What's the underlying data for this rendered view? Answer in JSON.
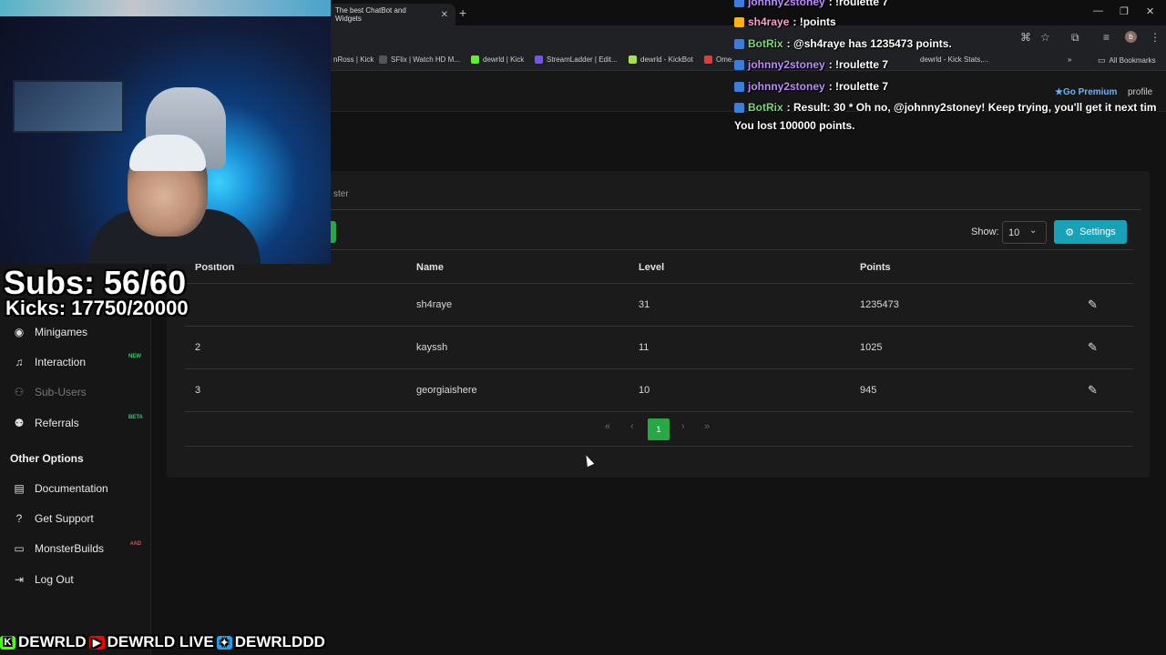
{
  "browser": {
    "tab_title": "The best ChatBot and Widgets",
    "bookmarks": [
      "nRoss | Kick",
      "SFlix | Watch HD M...",
      "dewrld | Kick",
      "StreamLadder | Edit...",
      "dewrld - KickBot",
      "Ome.."
    ],
    "bookmarks_right": [
      "dewrld - Kick Stats,...",
      "All Bookmarks"
    ]
  },
  "header": {
    "premium_label": "Go Premium",
    "profile_label": "profile"
  },
  "sidebar": {
    "items": [
      {
        "label": "Minigames",
        "icon": "gamepad-icon",
        "badge": ""
      },
      {
        "label": "Interaction",
        "icon": "music-icon",
        "badge": "NEW"
      },
      {
        "label": "Sub-Users",
        "icon": "users-icon",
        "badge": ""
      },
      {
        "label": "Referrals",
        "icon": "referral-icon",
        "badge": "BETA"
      }
    ],
    "section_heading": "Other Options",
    "options": [
      {
        "label": "Documentation",
        "icon": "book-icon",
        "badge": ""
      },
      {
        "label": "Get Support",
        "icon": "question-icon",
        "badge": ""
      },
      {
        "label": "MonsterBuilds",
        "icon": "laptop-icon",
        "badge": "#AD"
      },
      {
        "label": "Log Out",
        "icon": "logout-icon",
        "badge": ""
      }
    ]
  },
  "main": {
    "tab_label": "ster",
    "show_label": "Show:",
    "show_value": "10",
    "settings_label": "Settings",
    "columns": [
      "Position",
      "Name",
      "Level",
      "Points"
    ],
    "rows": [
      {
        "position": "",
        "name": "sh4raye",
        "level": "31",
        "points": "1235473"
      },
      {
        "position": "2",
        "name": "kayssh",
        "level": "11",
        "points": "1025"
      },
      {
        "position": "3",
        "name": "georgiaishere",
        "level": "10",
        "points": "945"
      }
    ],
    "pagination": {
      "first": "«",
      "prev": "‹",
      "current": "1",
      "next": "›",
      "last": "»"
    }
  },
  "overlay": {
    "subs": "Subs: 56/60",
    "kicks": "Kicks: 17750/20000",
    "socials": [
      {
        "icon": "kick-icon",
        "label": "DEWRLD",
        "color": "#53fc18"
      },
      {
        "icon": "youtube-icon",
        "label": "DEWRLD LIVE",
        "color": "#ff0000"
      },
      {
        "icon": "twitter-icon",
        "label": "DEWRLDDD",
        "color": "#1da1f2"
      }
    ]
  },
  "chat": [
    {
      "user": "johnny2stoney",
      "message": ": !roulette 7",
      "class": "user-j"
    },
    {
      "user": "sh4raye",
      "message": ": !points",
      "class": "user-s"
    },
    {
      "user": "BotRix",
      "message": ": @sh4raye has 1235473 points.",
      "class": "user-b"
    },
    {
      "user": "johnny2stoney",
      "message": ": !roulette 7",
      "class": "user-j"
    },
    {
      "user": "johnny2stoney",
      "message": ": !roulette 7",
      "class": "user-j"
    },
    {
      "user": "BotRix",
      "message": ": Result: 30 * Oh no, @johnny2stoney! Keep trying, you'll get it next tim",
      "class": "user-b"
    }
  ],
  "chat_continuation": "You lost 100000 points."
}
